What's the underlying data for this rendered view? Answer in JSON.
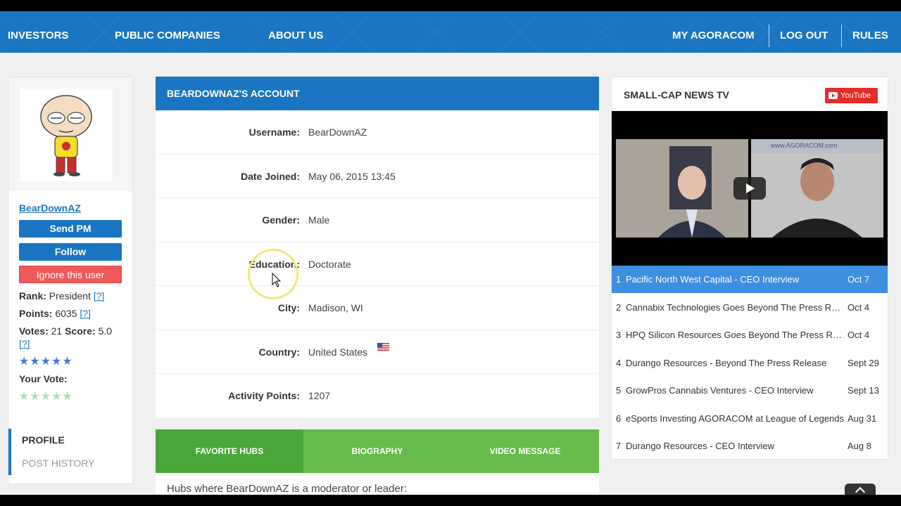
{
  "nav": {
    "investors": "INVESTORS",
    "public_companies": "PUBLIC COMPANIES",
    "about_us": "ABOUT US",
    "my_agoracom": "MY AGORACOM",
    "log_out": "LOG OUT",
    "rules": "RULES"
  },
  "sidebar": {
    "username": "BearDownAZ",
    "send_pm": "Send PM",
    "follow": "Follow",
    "ignore": "Ignore this user",
    "rank_label": "Rank:",
    "rank_value": "President",
    "points_label": "Points:",
    "points_value": "6035",
    "votes_label": "Votes:",
    "votes_value": "21",
    "score_label": "Score:",
    "score_value": "5.0",
    "help": "[?]",
    "rating_stars": 5,
    "your_vote_label": "Your Vote:",
    "profile": "PROFILE",
    "post_history": "POST HISTORY"
  },
  "account": {
    "title": "BEARDOWNAZ'S ACCOUNT",
    "rows": [
      {
        "label": "Username:",
        "value": "BearDownAZ"
      },
      {
        "label": "Date Joined:",
        "value": "May 06, 2015 13:45"
      },
      {
        "label": "Gender:",
        "value": "Male"
      },
      {
        "label": "Education:",
        "value": "Doctorate"
      },
      {
        "label": "City:",
        "value": "Madison, WI"
      },
      {
        "label": "Country:",
        "value": "United States"
      },
      {
        "label": "Activity Points:",
        "value": "1207"
      }
    ],
    "tabs": [
      "FAVORITE HUBS",
      "BIOGRAPHY",
      "VIDEO MESSAGE"
    ],
    "tab_content": "Hubs where BearDownAZ is a moderator or leader:"
  },
  "news": {
    "title": "SMALL-CAP NEWS TV",
    "youtube": "YouTube",
    "video_watermark": "www.AGORACOM.com",
    "playlist": [
      {
        "n": "1",
        "title": "Pacific North West Capital - CEO Interview",
        "date": "Oct 7"
      },
      {
        "n": "2",
        "title": "Cannabix Technologies Goes Beyond The Press Release",
        "date": "Oct 4"
      },
      {
        "n": "3",
        "title": "HPQ Silicon Resources Goes Beyond The Press Release",
        "date": "Oct 4"
      },
      {
        "n": "4",
        "title": "Durango Resources - Beyond The Press Release",
        "date": "Sept 29"
      },
      {
        "n": "5",
        "title": "GrowPros Cannabis Ventures - CEO Interview",
        "date": "Sept 13"
      },
      {
        "n": "6",
        "title": "eSports Investing AGORACOM at League of Legends",
        "date": "Aug 31"
      },
      {
        "n": "7",
        "title": "Durango Resources - CEO Interview",
        "date": "Aug 8"
      }
    ]
  },
  "colors": {
    "brand_blue": "#1a76c2",
    "tab_green": "#66bb4a",
    "playlist_active": "#3d8fe0",
    "ignore_red": "#ee5a5a"
  }
}
